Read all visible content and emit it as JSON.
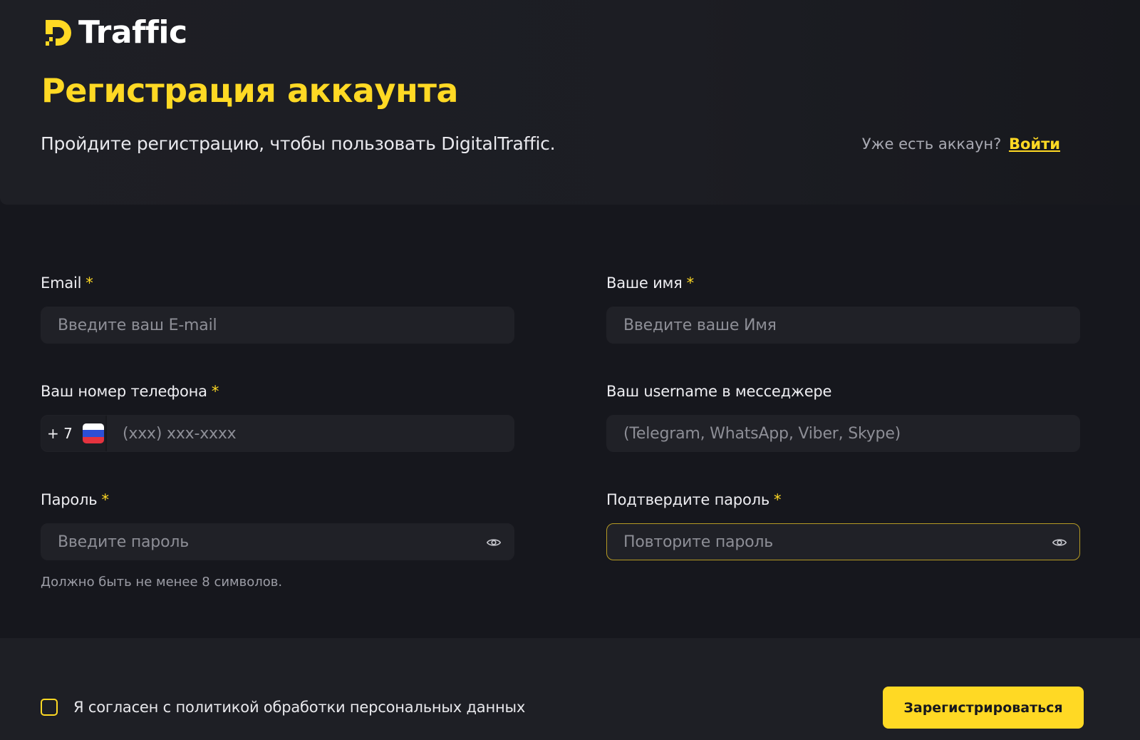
{
  "brand": {
    "name": "Traffic",
    "accent": "#ffd924"
  },
  "header": {
    "title": "Регистрация аккаунта",
    "subtitle": "Пройдите регистрацию, чтобы пользовать DigitalTraffic.",
    "login_prompt": "Уже есть аккаун?",
    "login_link": "Войти"
  },
  "form": {
    "email": {
      "label": "Email",
      "required_mark": "*",
      "placeholder": "Введите ваш E-mail"
    },
    "name": {
      "label": "Ваше имя",
      "required_mark": "*",
      "placeholder": "Введите ваше Имя"
    },
    "phone": {
      "label": "Ваш номер телефона",
      "required_mark": "*",
      "country_code": "+ 7",
      "country_flag": "ru-flag-icon",
      "placeholder": "(xxx) xxx-xxxx"
    },
    "messenger": {
      "label": "Ваш username в месседжере",
      "placeholder": "(Telegram, WhatsApp, Viber, Skype)"
    },
    "password": {
      "label": "Пароль",
      "required_mark": "*",
      "placeholder": "Введите пароль",
      "hint": "Должно быть не менее 8 символов.",
      "icon": "eye-icon"
    },
    "confirm_password": {
      "label": "Подтвердите пароль",
      "required_mark": "*",
      "placeholder": "Повторите пароль",
      "icon": "eye-icon",
      "focused": true
    }
  },
  "footer": {
    "consent_label": "Я согласен с политикой обработки персональных данных",
    "consent_checked": false,
    "submit_label": "Зарегистрироваться"
  }
}
